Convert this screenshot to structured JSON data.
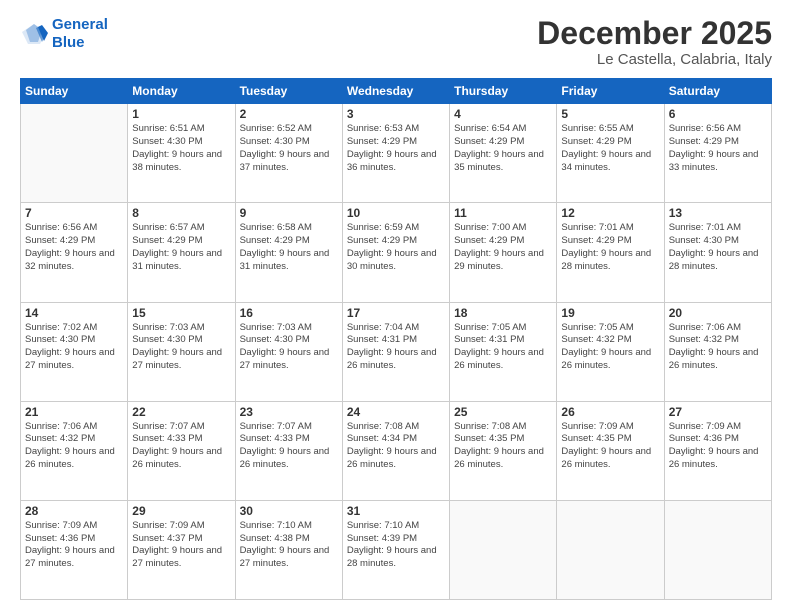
{
  "logo": {
    "line1": "General",
    "line2": "Blue"
  },
  "header": {
    "month": "December 2025",
    "location": "Le Castella, Calabria, Italy"
  },
  "weekdays": [
    "Sunday",
    "Monday",
    "Tuesday",
    "Wednesday",
    "Thursday",
    "Friday",
    "Saturday"
  ],
  "weeks": [
    [
      {
        "day": "",
        "sunrise": "",
        "sunset": "",
        "daylight": ""
      },
      {
        "day": "1",
        "sunrise": "Sunrise: 6:51 AM",
        "sunset": "Sunset: 4:30 PM",
        "daylight": "Daylight: 9 hours and 38 minutes."
      },
      {
        "day": "2",
        "sunrise": "Sunrise: 6:52 AM",
        "sunset": "Sunset: 4:30 PM",
        "daylight": "Daylight: 9 hours and 37 minutes."
      },
      {
        "day": "3",
        "sunrise": "Sunrise: 6:53 AM",
        "sunset": "Sunset: 4:29 PM",
        "daylight": "Daylight: 9 hours and 36 minutes."
      },
      {
        "day": "4",
        "sunrise": "Sunrise: 6:54 AM",
        "sunset": "Sunset: 4:29 PM",
        "daylight": "Daylight: 9 hours and 35 minutes."
      },
      {
        "day": "5",
        "sunrise": "Sunrise: 6:55 AM",
        "sunset": "Sunset: 4:29 PM",
        "daylight": "Daylight: 9 hours and 34 minutes."
      },
      {
        "day": "6",
        "sunrise": "Sunrise: 6:56 AM",
        "sunset": "Sunset: 4:29 PM",
        "daylight": "Daylight: 9 hours and 33 minutes."
      }
    ],
    [
      {
        "day": "7",
        "sunrise": "Sunrise: 6:56 AM",
        "sunset": "Sunset: 4:29 PM",
        "daylight": "Daylight: 9 hours and 32 minutes."
      },
      {
        "day": "8",
        "sunrise": "Sunrise: 6:57 AM",
        "sunset": "Sunset: 4:29 PM",
        "daylight": "Daylight: 9 hours and 31 minutes."
      },
      {
        "day": "9",
        "sunrise": "Sunrise: 6:58 AM",
        "sunset": "Sunset: 4:29 PM",
        "daylight": "Daylight: 9 hours and 31 minutes."
      },
      {
        "day": "10",
        "sunrise": "Sunrise: 6:59 AM",
        "sunset": "Sunset: 4:29 PM",
        "daylight": "Daylight: 9 hours and 30 minutes."
      },
      {
        "day": "11",
        "sunrise": "Sunrise: 7:00 AM",
        "sunset": "Sunset: 4:29 PM",
        "daylight": "Daylight: 9 hours and 29 minutes."
      },
      {
        "day": "12",
        "sunrise": "Sunrise: 7:01 AM",
        "sunset": "Sunset: 4:29 PM",
        "daylight": "Daylight: 9 hours and 28 minutes."
      },
      {
        "day": "13",
        "sunrise": "Sunrise: 7:01 AM",
        "sunset": "Sunset: 4:30 PM",
        "daylight": "Daylight: 9 hours and 28 minutes."
      }
    ],
    [
      {
        "day": "14",
        "sunrise": "Sunrise: 7:02 AM",
        "sunset": "Sunset: 4:30 PM",
        "daylight": "Daylight: 9 hours and 27 minutes."
      },
      {
        "day": "15",
        "sunrise": "Sunrise: 7:03 AM",
        "sunset": "Sunset: 4:30 PM",
        "daylight": "Daylight: 9 hours and 27 minutes."
      },
      {
        "day": "16",
        "sunrise": "Sunrise: 7:03 AM",
        "sunset": "Sunset: 4:30 PM",
        "daylight": "Daylight: 9 hours and 27 minutes."
      },
      {
        "day": "17",
        "sunrise": "Sunrise: 7:04 AM",
        "sunset": "Sunset: 4:31 PM",
        "daylight": "Daylight: 9 hours and 26 minutes."
      },
      {
        "day": "18",
        "sunrise": "Sunrise: 7:05 AM",
        "sunset": "Sunset: 4:31 PM",
        "daylight": "Daylight: 9 hours and 26 minutes."
      },
      {
        "day": "19",
        "sunrise": "Sunrise: 7:05 AM",
        "sunset": "Sunset: 4:32 PM",
        "daylight": "Daylight: 9 hours and 26 minutes."
      },
      {
        "day": "20",
        "sunrise": "Sunrise: 7:06 AM",
        "sunset": "Sunset: 4:32 PM",
        "daylight": "Daylight: 9 hours and 26 minutes."
      }
    ],
    [
      {
        "day": "21",
        "sunrise": "Sunrise: 7:06 AM",
        "sunset": "Sunset: 4:32 PM",
        "daylight": "Daylight: 9 hours and 26 minutes."
      },
      {
        "day": "22",
        "sunrise": "Sunrise: 7:07 AM",
        "sunset": "Sunset: 4:33 PM",
        "daylight": "Daylight: 9 hours and 26 minutes."
      },
      {
        "day": "23",
        "sunrise": "Sunrise: 7:07 AM",
        "sunset": "Sunset: 4:33 PM",
        "daylight": "Daylight: 9 hours and 26 minutes."
      },
      {
        "day": "24",
        "sunrise": "Sunrise: 7:08 AM",
        "sunset": "Sunset: 4:34 PM",
        "daylight": "Daylight: 9 hours and 26 minutes."
      },
      {
        "day": "25",
        "sunrise": "Sunrise: 7:08 AM",
        "sunset": "Sunset: 4:35 PM",
        "daylight": "Daylight: 9 hours and 26 minutes."
      },
      {
        "day": "26",
        "sunrise": "Sunrise: 7:09 AM",
        "sunset": "Sunset: 4:35 PM",
        "daylight": "Daylight: 9 hours and 26 minutes."
      },
      {
        "day": "27",
        "sunrise": "Sunrise: 7:09 AM",
        "sunset": "Sunset: 4:36 PM",
        "daylight": "Daylight: 9 hours and 26 minutes."
      }
    ],
    [
      {
        "day": "28",
        "sunrise": "Sunrise: 7:09 AM",
        "sunset": "Sunset: 4:36 PM",
        "daylight": "Daylight: 9 hours and 27 minutes."
      },
      {
        "day": "29",
        "sunrise": "Sunrise: 7:09 AM",
        "sunset": "Sunset: 4:37 PM",
        "daylight": "Daylight: 9 hours and 27 minutes."
      },
      {
        "day": "30",
        "sunrise": "Sunrise: 7:10 AM",
        "sunset": "Sunset: 4:38 PM",
        "daylight": "Daylight: 9 hours and 27 minutes."
      },
      {
        "day": "31",
        "sunrise": "Sunrise: 7:10 AM",
        "sunset": "Sunset: 4:39 PM",
        "daylight": "Daylight: 9 hours and 28 minutes."
      },
      {
        "day": "",
        "sunrise": "",
        "sunset": "",
        "daylight": ""
      },
      {
        "day": "",
        "sunrise": "",
        "sunset": "",
        "daylight": ""
      },
      {
        "day": "",
        "sunrise": "",
        "sunset": "",
        "daylight": ""
      }
    ]
  ]
}
